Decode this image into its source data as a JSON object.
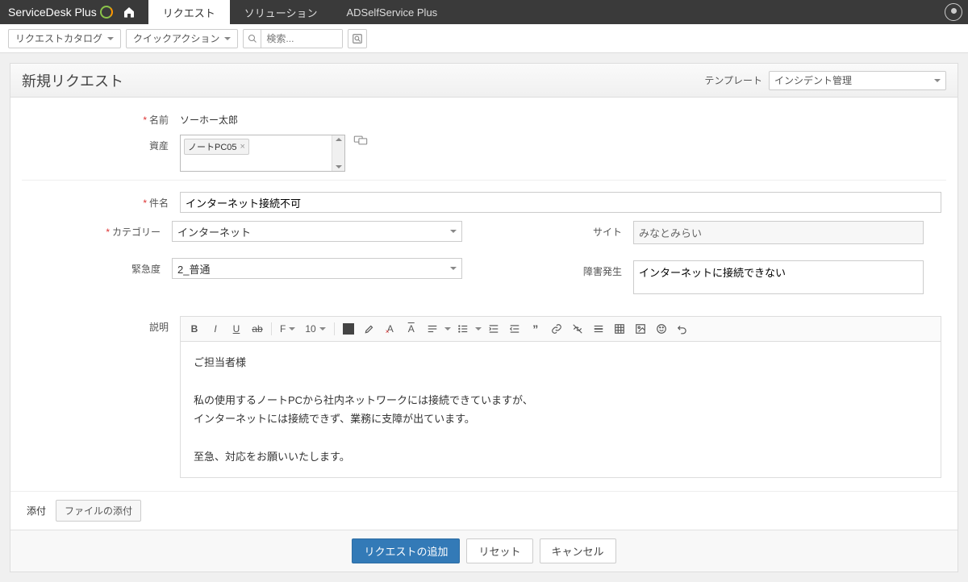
{
  "brand": "ServiceDesk Plus",
  "nav": {
    "tabs": [
      {
        "label": "リクエスト",
        "active": true
      },
      {
        "label": "ソリューション",
        "active": false
      },
      {
        "label": "ADSelfService Plus",
        "active": false
      }
    ]
  },
  "toolbar": {
    "catalog": "リクエストカタログ",
    "quickaction": "クイックアクション",
    "search_placeholder": "検索..."
  },
  "page": {
    "title": "新規リクエスト",
    "template_label": "テンプレート",
    "template_value": "インシデント管理"
  },
  "form": {
    "name_label": "名前",
    "name_value": "ソーホー太郎",
    "asset_label": "資産",
    "asset_value": "ノートPC05",
    "subject_label": "件名",
    "subject_value": "インターネット接続不可",
    "category_label": "カテゴリー",
    "category_value": "インターネット",
    "urgency_label": "緊急度",
    "urgency_value": "2_普通",
    "site_label": "サイト",
    "site_value": "みなとみらい",
    "fault_label": "障害発生",
    "fault_value": "インターネットに接続できない",
    "desc_label": "説明",
    "fontsize": "10",
    "desc_lines": {
      "l1": "ご担当者様",
      "l2": "私の使用するノートPCから社内ネットワークには接続できていますが、",
      "l3": "インターネットには接続できず、業務に支障が出ています。",
      "l4": "至急、対応をお願いいたします。"
    },
    "attach_label": "添付",
    "attach_button": "ファイルの添付"
  },
  "buttons": {
    "submit": "リクエストの追加",
    "reset": "リセット",
    "cancel": "キャンセル"
  }
}
